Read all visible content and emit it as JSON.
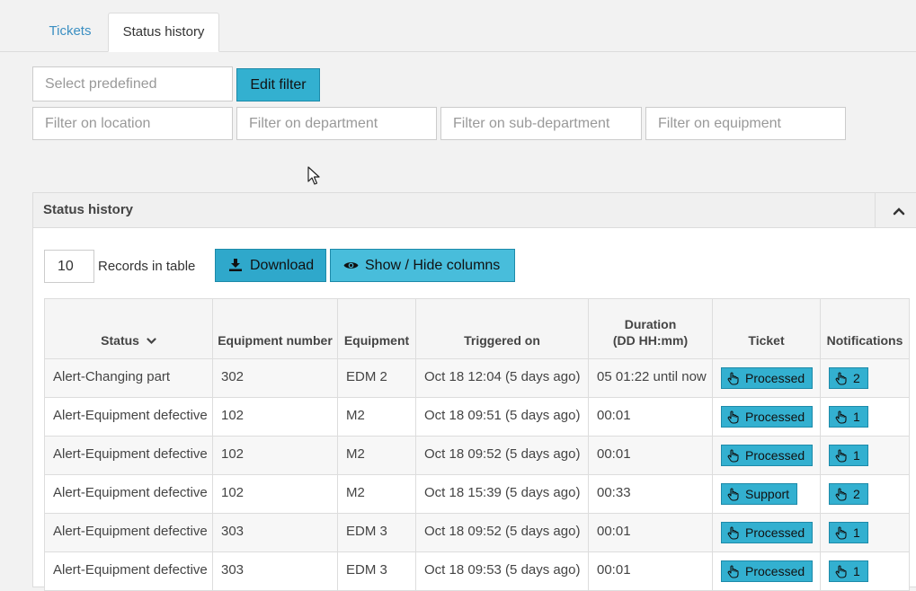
{
  "tabs": [
    {
      "label": "Tickets",
      "active": false
    },
    {
      "label": "Status history",
      "active": true
    }
  ],
  "filters": {
    "predefined_placeholder": "Select predefined",
    "edit_filter_label": "Edit filter",
    "location_placeholder": "Filter on location",
    "department_placeholder": "Filter on department",
    "subdepartment_placeholder": "Filter on sub-department",
    "equipment_placeholder": "Filter on equipment"
  },
  "panel": {
    "title": "Status history",
    "records_value": "10",
    "records_label": "Records in table",
    "download_label": "Download",
    "show_hide_label": "Show / Hide columns"
  },
  "table": {
    "headers": {
      "status": "Status",
      "equipment_number": "Equipment number",
      "equipment": "Equipment",
      "triggered_on": "Triggered on",
      "duration_line1": "Duration",
      "duration_line2": "(DD HH:mm)",
      "ticket": "Ticket",
      "notifications": "Notifications"
    },
    "rows": [
      {
        "status": "Alert-Changing part",
        "equipment_number": "302",
        "equipment": "EDM 2",
        "triggered_on": "Oct 18 12:04 (5 days ago)",
        "duration": "05 01:22 until now",
        "ticket": "Processed",
        "notifications": "2"
      },
      {
        "status": "Alert-Equipment defective",
        "equipment_number": "102",
        "equipment": "M2",
        "triggered_on": "Oct 18 09:51 (5 days ago)",
        "duration": "00:01",
        "ticket": "Processed",
        "notifications": "1"
      },
      {
        "status": "Alert-Equipment defective",
        "equipment_number": "102",
        "equipment": "M2",
        "triggered_on": "Oct 18 09:52 (5 days ago)",
        "duration": "00:01",
        "ticket": "Processed",
        "notifications": "1"
      },
      {
        "status": "Alert-Equipment defective",
        "equipment_number": "102",
        "equipment": "M2",
        "triggered_on": "Oct 18 15:39 (5 days ago)",
        "duration": "00:33",
        "ticket": "Support",
        "notifications": "2"
      },
      {
        "status": "Alert-Equipment defective",
        "equipment_number": "303",
        "equipment": "EDM 3",
        "triggered_on": "Oct 18 09:52 (5 days ago)",
        "duration": "00:01",
        "ticket": "Processed",
        "notifications": "1"
      },
      {
        "status": "Alert-Equipment defective",
        "equipment_number": "303",
        "equipment": "EDM 3",
        "triggered_on": "Oct 18 09:53 (5 days ago)",
        "duration": "00:01",
        "ticket": "Processed",
        "notifications": "1"
      }
    ]
  },
  "colors": {
    "accent": "#33b0d0",
    "accent_border": "#1d8aa9",
    "tab_link": "#3b8fc2",
    "background": "#f2f2f2"
  }
}
